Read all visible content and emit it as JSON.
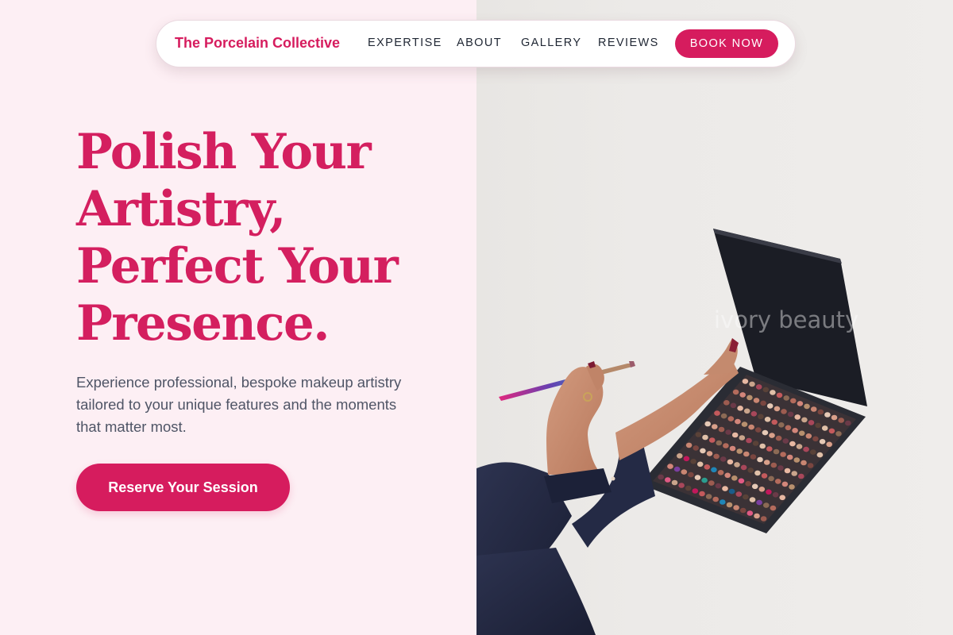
{
  "colors": {
    "accent": "#d61c5e",
    "left_background": "#fdeff4",
    "nav_text": "#1f2633",
    "body_text": "#4f5566"
  },
  "nav": {
    "brand": "The Porcelain Collective",
    "links": [
      "EXPERTISE",
      "ABOUT",
      "GALLERY",
      "REVIEWS"
    ],
    "cta_label": "BOOK NOW"
  },
  "hero": {
    "headline_lines": [
      "Polish Your",
      "Artistry,",
      "Perfect Your",
      "Presence."
    ],
    "subtext": "Experience professional, bespoke makeup artistry tailored to your unique features and the moments that matter most.",
    "cta_label": "Reserve Your Session"
  },
  "image": {
    "watermark": "ivory beauty",
    "icon": "makeup-palette-photo"
  }
}
